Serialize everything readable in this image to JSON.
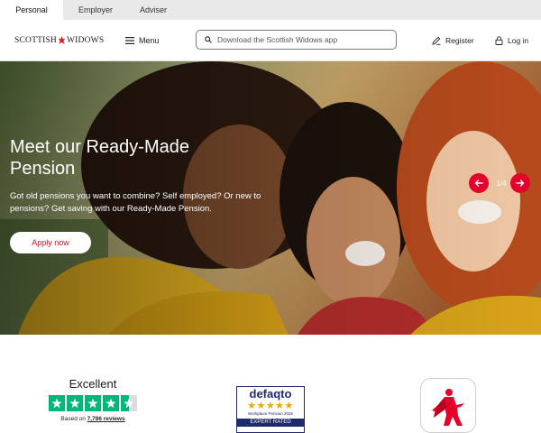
{
  "audience_tabs": [
    {
      "label": "Personal",
      "active": true
    },
    {
      "label": "Employer",
      "active": false
    },
    {
      "label": "Adviser",
      "active": false
    }
  ],
  "header": {
    "logo_left": "SCOTTISH",
    "logo_right": "WIDOWS",
    "menu_label": "Menu",
    "search_placeholder": "Download the Scottish Widows app",
    "register_label": "Register",
    "login_label": "Log in"
  },
  "hero": {
    "title": "Meet our Ready-Made Pension",
    "description": "Got old pensions you want to combine? Self employed? Or new to pensions? Get saving with our Ready-Made Pension.",
    "cta_label": "Apply now",
    "slide_counter": "1/4"
  },
  "trust": {
    "trustpilot": {
      "label": "Excellent",
      "stars": 4.5,
      "based_on_prefix": "Based on ",
      "review_count": "7,786 reviews"
    },
    "defaqto": {
      "logo": "defaqto",
      "stars": 5,
      "category": "Workplace Pension 2025",
      "badge": "EXPERT RATED"
    }
  },
  "colors": {
    "brand_red": "#e4002b",
    "trustpilot_green": "#00b67a",
    "defaqto_navy": "#1f2a6b",
    "tab_bar": "#e9e9ea"
  }
}
